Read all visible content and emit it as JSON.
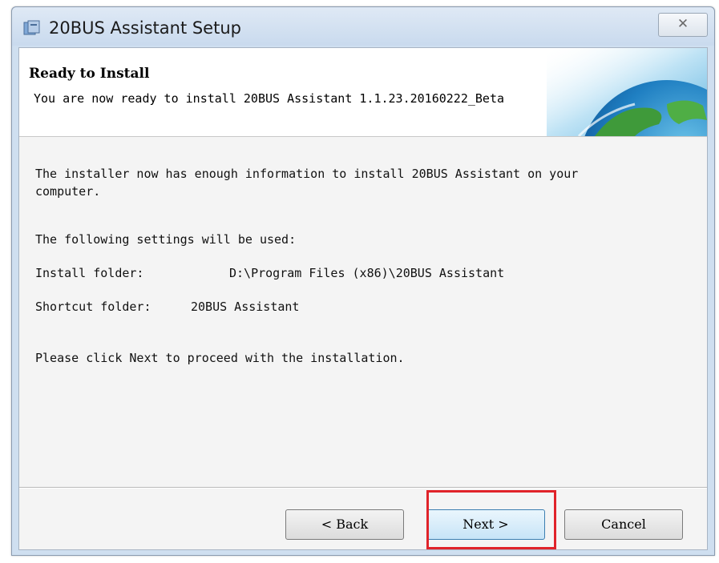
{
  "window": {
    "title": "20BUS Assistant Setup",
    "close_glyph": "✕"
  },
  "header": {
    "title": "Ready to Install",
    "subtitle": "You are now ready to install 20BUS Assistant 1.1.23.20160222_Beta"
  },
  "body": {
    "intro_line1": "The installer now has enough information to install 20BUS Assistant on your",
    "intro_line2": "computer.",
    "settings_heading": "The following settings will be used:",
    "install_folder_label": "Install folder:",
    "install_folder_value": "D:\\Program Files (x86)\\20BUS Assistant",
    "shortcut_folder_label": "Shortcut folder:",
    "shortcut_folder_value": "20BUS Assistant",
    "proceed_text": "Please click Next to proceed with the installation."
  },
  "buttons": {
    "back": "< Back",
    "next": "Next >",
    "cancel": "Cancel"
  },
  "colors": {
    "highlight": "#e0232a"
  }
}
